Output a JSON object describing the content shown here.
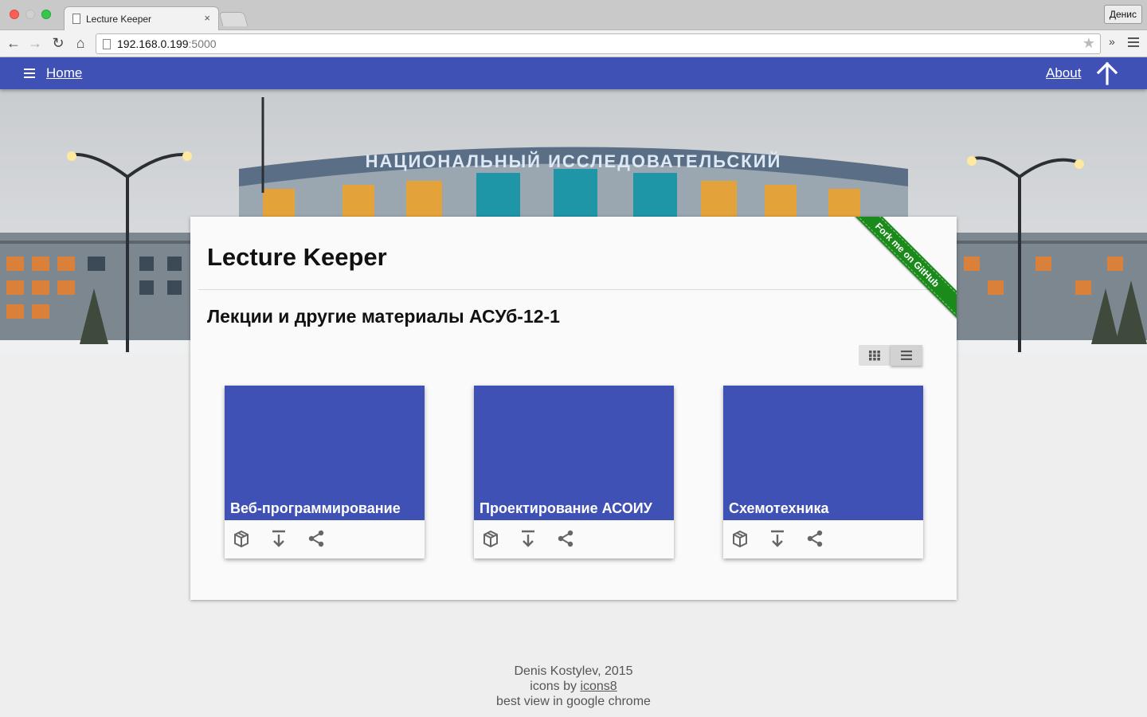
{
  "browser": {
    "tab_title": "Lecture Keeper",
    "tab_close": "×",
    "user_name": "Денис",
    "url_host": "192.168.0.199",
    "url_port": ":5000",
    "back": "←",
    "forward": "→",
    "reload": "↻",
    "home": "⌂",
    "star": "★",
    "extensions_chevron": "»"
  },
  "appbar": {
    "home_label": "Home",
    "about_label": "About",
    "menu_icon": "hamburger-icon",
    "up_icon": "arrow-up-icon",
    "color": "#3f51b5"
  },
  "main": {
    "title": "Lecture Keeper",
    "subtitle": "Лекции и другие материалы АСУб-12-1",
    "ribbon": "Fork me on GitHub",
    "view_toggle": [
      "grid-view-icon",
      "list-view-icon"
    ]
  },
  "courses": [
    {
      "title": "Веб-программирование"
    },
    {
      "title": "Проектирование АСОИУ"
    },
    {
      "title": "Схемотехника"
    }
  ],
  "course_actions": [
    "package-icon",
    "download-icon",
    "share-icon"
  ],
  "footer": {
    "author": "Denis Kostylev, 2015",
    "icons_prefix": "icons by ",
    "icons_link": "icons8",
    "note": "best view in google chrome"
  }
}
